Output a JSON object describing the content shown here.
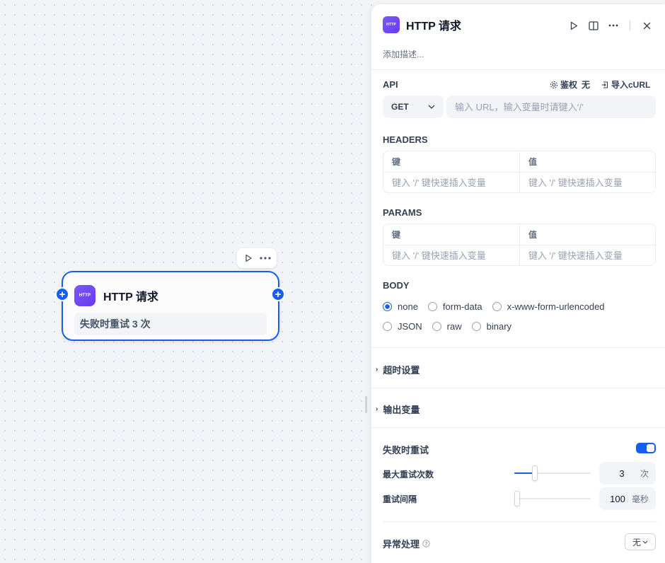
{
  "node": {
    "logo_text": "HTTP",
    "title": "HTTP 请求",
    "retry_text": "失败时重试 3 次",
    "handle_symbol": "+"
  },
  "panel": {
    "logo_text": "HTTP",
    "title": "HTTP 请求",
    "description_placeholder": "添加描述...",
    "api": {
      "label": "API",
      "auth_label": "鉴权",
      "auth_value": "无",
      "import_label": "导入cURL",
      "method": "GET",
      "url_placeholder": "输入 URL，输入变量时请键入‘/’"
    },
    "headers": {
      "label": "HEADERS",
      "key_header": "键",
      "value_header": "值",
      "key_placeholder": "键入 '/' 键快速插入变量",
      "value_placeholder": "键入 '/' 键快速插入变量"
    },
    "params": {
      "label": "PARAMS",
      "key_header": "键",
      "value_header": "值",
      "key_placeholder": "键入 '/' 键快速插入变量",
      "value_placeholder": "键入 '/' 键快速插入变量"
    },
    "body": {
      "label": "BODY",
      "options": [
        "none",
        "form-data",
        "x-www-form-urlencoded",
        "JSON",
        "raw",
        "binary"
      ],
      "selected": "none"
    },
    "timeout_label": "超时设置",
    "output_label": "输出变量",
    "retry": {
      "label": "失败时重试",
      "enabled": true,
      "max_retries_label": "最大重试次数",
      "max_retries_value": "3",
      "max_retries_unit": "次",
      "max_retries_fraction": 0.25,
      "interval_label": "重试间隔",
      "interval_value": "100",
      "interval_unit": "毫秒",
      "interval_fraction": 0.0
    },
    "error_handling": {
      "label": "异常处理",
      "value": "无"
    }
  },
  "colors": {
    "accent": "#155eef",
    "logo": "#6938ef"
  },
  "icons": [
    "play-icon",
    "more-icon",
    "split-view-icon",
    "close-icon",
    "gear-icon",
    "import-icon",
    "chevron-down-icon",
    "chevron-right-icon",
    "help-icon"
  ]
}
